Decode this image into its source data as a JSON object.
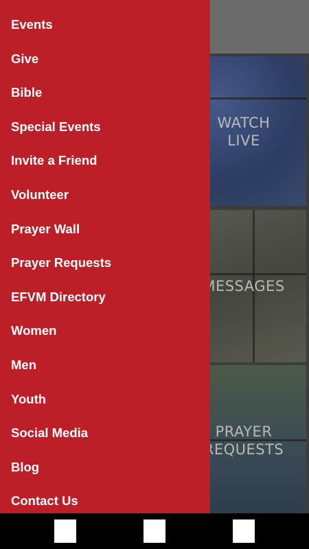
{
  "drawer": {
    "items": [
      {
        "label": "Events"
      },
      {
        "label": "Give"
      },
      {
        "label": "Bible"
      },
      {
        "label": "Special Events"
      },
      {
        "label": "Invite a Friend"
      },
      {
        "label": "Volunteer"
      },
      {
        "label": "Prayer Wall"
      },
      {
        "label": "Prayer Requests"
      },
      {
        "label": "EFVM Directory"
      },
      {
        "label": "Women"
      },
      {
        "label": "Men"
      },
      {
        "label": "Youth"
      },
      {
        "label": "Social Media"
      },
      {
        "label": "Blog"
      },
      {
        "label": "Contact Us"
      }
    ]
  },
  "background": {
    "tiles": [
      {
        "line1": "WATCH",
        "line2": "LIVE"
      },
      {
        "line1": "MESSAGES",
        "line2": ""
      },
      {
        "line1": "PRAYER",
        "line2": "REQUESTS"
      }
    ]
  },
  "colors": {
    "drawer": "#bd1f29",
    "drawer_text": "#ffffff",
    "navbar": "#000000"
  },
  "navbar": {
    "icons": [
      "back-icon",
      "home-icon",
      "recent-apps-icon"
    ]
  }
}
